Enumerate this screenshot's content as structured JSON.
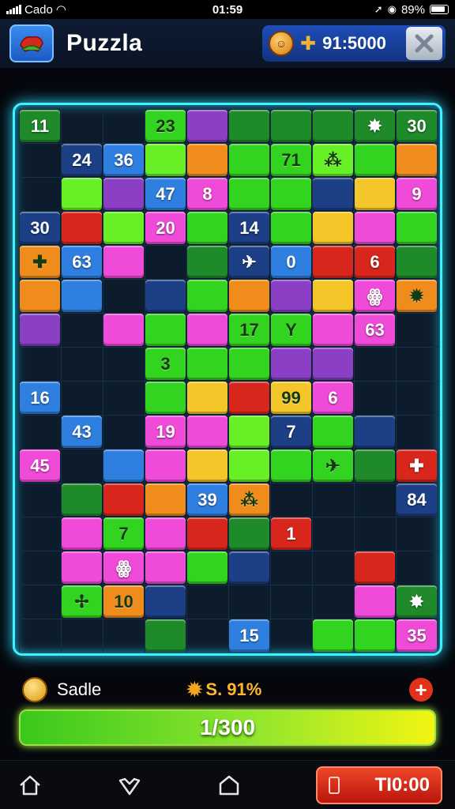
{
  "status_bar": {
    "carrier": "Cado",
    "time": "01:59",
    "battery": "89%"
  },
  "header": {
    "title": "Puzzla",
    "score": "91:5000",
    "icons": {
      "app": "puzzle-piece-icon",
      "coin": "coin-icon",
      "gem": "plus-gem-icon",
      "close": "close-icon"
    }
  },
  "board": {
    "rows": 16,
    "cols": 10,
    "colors": {
      "green": "#33d41f",
      "lime": "#67f026",
      "dark_green": "#1f8a2a",
      "pink": "#f04ad9",
      "purple": "#8a3fc4",
      "blue": "#2f7fe0",
      "navy": "#1d3f86",
      "orange": "#f08c1c",
      "yellow": "#f5c629",
      "red": "#d8261c"
    },
    "tiles": [
      {
        "r": 0,
        "c": 0,
        "color": "dark_green",
        "label": "11"
      },
      {
        "r": 0,
        "c": 3,
        "color": "green",
        "label": "23"
      },
      {
        "r": 0,
        "c": 4,
        "color": "purple",
        "label": ""
      },
      {
        "r": 0,
        "c": 5,
        "color": "dark_green",
        "label": ""
      },
      {
        "r": 0,
        "c": 6,
        "color": "dark_green",
        "label": ""
      },
      {
        "r": 0,
        "c": 7,
        "color": "dark_green",
        "label": ""
      },
      {
        "r": 0,
        "c": 8,
        "color": "dark_green",
        "label": "✸"
      },
      {
        "r": 0,
        "c": 9,
        "color": "dark_green",
        "label": "30"
      },
      {
        "r": 1,
        "c": 1,
        "color": "navy",
        "label": "24"
      },
      {
        "r": 1,
        "c": 2,
        "color": "blue",
        "label": "36"
      },
      {
        "r": 1,
        "c": 3,
        "color": "lime",
        "label": ""
      },
      {
        "r": 1,
        "c": 4,
        "color": "orange",
        "label": ""
      },
      {
        "r": 1,
        "c": 5,
        "color": "green",
        "label": ""
      },
      {
        "r": 1,
        "c": 6,
        "color": "green",
        "label": "71"
      },
      {
        "r": 1,
        "c": 7,
        "color": "lime",
        "label": "⁂"
      },
      {
        "r": 1,
        "c": 8,
        "color": "green",
        "label": ""
      },
      {
        "r": 1,
        "c": 9,
        "color": "orange",
        "label": ""
      },
      {
        "r": 2,
        "c": 1,
        "color": "lime",
        "label": ""
      },
      {
        "r": 2,
        "c": 2,
        "color": "purple",
        "label": ""
      },
      {
        "r": 2,
        "c": 3,
        "color": "blue",
        "label": "47"
      },
      {
        "r": 2,
        "c": 4,
        "color": "pink",
        "label": "8"
      },
      {
        "r": 2,
        "c": 5,
        "color": "green",
        "label": ""
      },
      {
        "r": 2,
        "c": 6,
        "color": "green",
        "label": ""
      },
      {
        "r": 2,
        "c": 7,
        "color": "navy",
        "label": ""
      },
      {
        "r": 2,
        "c": 8,
        "color": "yellow",
        "label": ""
      },
      {
        "r": 2,
        "c": 9,
        "color": "pink",
        "label": "9"
      },
      {
        "r": 3,
        "c": 0,
        "color": "navy",
        "label": "30"
      },
      {
        "r": 3,
        "c": 1,
        "color": "red",
        "label": ""
      },
      {
        "r": 3,
        "c": 2,
        "color": "lime",
        "label": ""
      },
      {
        "r": 3,
        "c": 3,
        "color": "pink",
        "label": "20"
      },
      {
        "r": 3,
        "c": 4,
        "color": "green",
        "label": ""
      },
      {
        "r": 3,
        "c": 5,
        "color": "navy",
        "label": "14"
      },
      {
        "r": 3,
        "c": 6,
        "color": "green",
        "label": ""
      },
      {
        "r": 3,
        "c": 7,
        "color": "yellow",
        "label": ""
      },
      {
        "r": 3,
        "c": 8,
        "color": "pink",
        "label": ""
      },
      {
        "r": 3,
        "c": 9,
        "color": "green",
        "label": ""
      },
      {
        "r": 4,
        "c": 0,
        "color": "orange",
        "label": "✚"
      },
      {
        "r": 4,
        "c": 1,
        "color": "blue",
        "label": "63"
      },
      {
        "r": 4,
        "c": 2,
        "color": "pink",
        "label": ""
      },
      {
        "r": 4,
        "c": 4,
        "color": "dark_green",
        "label": ""
      },
      {
        "r": 4,
        "c": 5,
        "color": "navy",
        "label": "✈"
      },
      {
        "r": 4,
        "c": 6,
        "color": "blue",
        "label": "0"
      },
      {
        "r": 4,
        "c": 7,
        "color": "red",
        "label": ""
      },
      {
        "r": 4,
        "c": 8,
        "color": "red",
        "label": "6"
      },
      {
        "r": 4,
        "c": 9,
        "color": "dark_green",
        "label": ""
      },
      {
        "r": 5,
        "c": 0,
        "color": "orange",
        "label": ""
      },
      {
        "r": 5,
        "c": 1,
        "color": "blue",
        "label": ""
      },
      {
        "r": 5,
        "c": 3,
        "color": "navy",
        "label": ""
      },
      {
        "r": 5,
        "c": 4,
        "color": "green",
        "label": ""
      },
      {
        "r": 5,
        "c": 5,
        "color": "orange",
        "label": ""
      },
      {
        "r": 5,
        "c": 6,
        "color": "purple",
        "label": ""
      },
      {
        "r": 5,
        "c": 7,
        "color": "yellow",
        "label": ""
      },
      {
        "r": 5,
        "c": 8,
        "color": "pink",
        "label": "ꙮ"
      },
      {
        "r": 5,
        "c": 9,
        "color": "orange",
        "label": "✹"
      },
      {
        "r": 6,
        "c": 0,
        "color": "purple",
        "label": ""
      },
      {
        "r": 6,
        "c": 2,
        "color": "pink",
        "label": ""
      },
      {
        "r": 6,
        "c": 3,
        "color": "green",
        "label": ""
      },
      {
        "r": 6,
        "c": 4,
        "color": "pink",
        "label": ""
      },
      {
        "r": 6,
        "c": 5,
        "color": "green",
        "label": "17"
      },
      {
        "r": 6,
        "c": 6,
        "color": "green",
        "label": "Y"
      },
      {
        "r": 6,
        "c": 7,
        "color": "pink",
        "label": ""
      },
      {
        "r": 6,
        "c": 8,
        "color": "pink",
        "label": "63"
      },
      {
        "r": 7,
        "c": 3,
        "color": "green",
        "label": "3"
      },
      {
        "r": 7,
        "c": 4,
        "color": "green",
        "label": ""
      },
      {
        "r": 7,
        "c": 5,
        "color": "green",
        "label": ""
      },
      {
        "r": 7,
        "c": 6,
        "color": "purple",
        "label": ""
      },
      {
        "r": 7,
        "c": 7,
        "color": "purple",
        "label": ""
      },
      {
        "r": 8,
        "c": 0,
        "color": "blue",
        "label": "16"
      },
      {
        "r": 8,
        "c": 3,
        "color": "green",
        "label": ""
      },
      {
        "r": 8,
        "c": 4,
        "color": "yellow",
        "label": ""
      },
      {
        "r": 8,
        "c": 5,
        "color": "red",
        "label": ""
      },
      {
        "r": 8,
        "c": 6,
        "color": "yellow",
        "label": "99"
      },
      {
        "r": 8,
        "c": 7,
        "color": "pink",
        "label": "6"
      },
      {
        "r": 9,
        "c": 1,
        "color": "blue",
        "label": "43"
      },
      {
        "r": 9,
        "c": 3,
        "color": "pink",
        "label": "19"
      },
      {
        "r": 9,
        "c": 4,
        "color": "pink",
        "label": ""
      },
      {
        "r": 9,
        "c": 5,
        "color": "lime",
        "label": ""
      },
      {
        "r": 9,
        "c": 6,
        "color": "navy",
        "label": "7"
      },
      {
        "r": 9,
        "c": 7,
        "color": "green",
        "label": ""
      },
      {
        "r": 9,
        "c": 8,
        "color": "navy",
        "label": ""
      },
      {
        "r": 10,
        "c": 0,
        "color": "pink",
        "label": "45"
      },
      {
        "r": 10,
        "c": 2,
        "color": "blue",
        "label": ""
      },
      {
        "r": 10,
        "c": 3,
        "color": "pink",
        "label": ""
      },
      {
        "r": 10,
        "c": 4,
        "color": "yellow",
        "label": ""
      },
      {
        "r": 10,
        "c": 5,
        "color": "lime",
        "label": ""
      },
      {
        "r": 10,
        "c": 6,
        "color": "green",
        "label": ""
      },
      {
        "r": 10,
        "c": 7,
        "color": "green",
        "label": "✈"
      },
      {
        "r": 10,
        "c": 8,
        "color": "dark_green",
        "label": ""
      },
      {
        "r": 10,
        "c": 9,
        "color": "red",
        "label": "✚"
      },
      {
        "r": 11,
        "c": 1,
        "color": "dark_green",
        "label": ""
      },
      {
        "r": 11,
        "c": 2,
        "color": "red",
        "label": ""
      },
      {
        "r": 11,
        "c": 3,
        "color": "orange",
        "label": ""
      },
      {
        "r": 11,
        "c": 4,
        "color": "blue",
        "label": "39"
      },
      {
        "r": 11,
        "c": 5,
        "color": "orange",
        "label": "⁂"
      },
      {
        "r": 11,
        "c": 9,
        "color": "navy",
        "label": "84"
      },
      {
        "r": 12,
        "c": 1,
        "color": "pink",
        "label": ""
      },
      {
        "r": 12,
        "c": 2,
        "color": "green",
        "label": "7"
      },
      {
        "r": 12,
        "c": 3,
        "color": "pink",
        "label": ""
      },
      {
        "r": 12,
        "c": 4,
        "color": "red",
        "label": ""
      },
      {
        "r": 12,
        "c": 5,
        "color": "dark_green",
        "label": ""
      },
      {
        "r": 12,
        "c": 6,
        "color": "red",
        "label": "1"
      },
      {
        "r": 13,
        "c": 1,
        "color": "pink",
        "label": ""
      },
      {
        "r": 13,
        "c": 2,
        "color": "pink",
        "label": "ꙮ"
      },
      {
        "r": 13,
        "c": 3,
        "color": "pink",
        "label": ""
      },
      {
        "r": 13,
        "c": 4,
        "color": "green",
        "label": ""
      },
      {
        "r": 13,
        "c": 5,
        "color": "navy",
        "label": ""
      },
      {
        "r": 13,
        "c": 8,
        "color": "red",
        "label": ""
      },
      {
        "r": 14,
        "c": 1,
        "color": "green",
        "label": "✢"
      },
      {
        "r": 14,
        "c": 2,
        "color": "orange",
        "label": "10"
      },
      {
        "r": 14,
        "c": 3,
        "color": "navy",
        "label": ""
      },
      {
        "r": 14,
        "c": 8,
        "color": "pink",
        "label": ""
      },
      {
        "r": 14,
        "c": 9,
        "color": "dark_green",
        "label": "✸"
      },
      {
        "r": 15,
        "c": 3,
        "color": "dark_green",
        "label": ""
      },
      {
        "r": 15,
        "c": 5,
        "color": "blue",
        "label": "15"
      },
      {
        "r": 15,
        "c": 7,
        "color": "green",
        "label": ""
      },
      {
        "r": 15,
        "c": 8,
        "color": "green",
        "label": ""
      },
      {
        "r": 15,
        "c": 9,
        "color": "pink",
        "label": "35"
      }
    ]
  },
  "info": {
    "label": "Sadle",
    "percent": "S. 91%",
    "icons": {
      "coin": "coin-icon",
      "star": "burst-icon",
      "add": "plus-icon"
    }
  },
  "progress": {
    "text": "1/300",
    "fraction": 1.0
  },
  "nav": {
    "icons": [
      "home-icon",
      "heart-plus-icon",
      "house-icon"
    ],
    "timer_label": "TI0:00"
  }
}
